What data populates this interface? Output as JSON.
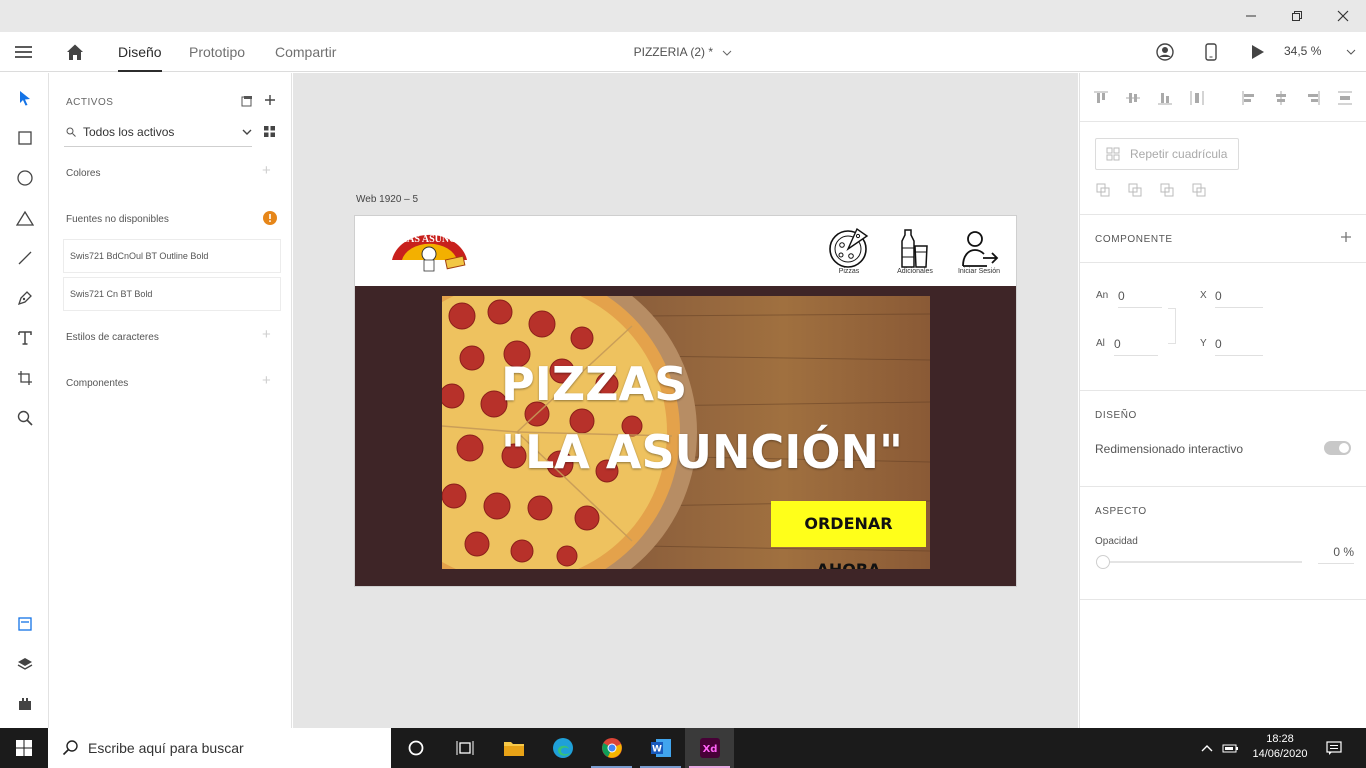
{
  "window": {
    "minimize_icon": "minimize-icon",
    "maximize_icon": "restore-icon",
    "close_icon": "close-icon"
  },
  "topbar": {
    "tabs": [
      {
        "label": "Diseño"
      },
      {
        "label": "Prototipo"
      },
      {
        "label": "Compartir"
      }
    ],
    "document_title": "PIZZERIA (2) *",
    "zoom": "34,5 %"
  },
  "assets": {
    "header": "ACTIVOS",
    "filter": "Todos los activos",
    "sections": {
      "colors": "Colores",
      "missing_fonts": "Fuentes no disponibles",
      "char_styles": "Estilos de caracteres",
      "components": "Componentes"
    },
    "missing_fonts": [
      "Swis721 BdCnOul BT Outline Bold",
      "Swis721 Cn BT Bold"
    ]
  },
  "canvas": {
    "artboard_label": "Web 1920 – 5",
    "logo_text": "PIZZAS ASUNCION",
    "nav": [
      {
        "label": "Pizzas",
        "icon": "pizza-icon"
      },
      {
        "label": "Adicionales",
        "icon": "drinks-icon"
      },
      {
        "label": "Iniciar Sesión",
        "icon": "login-icon"
      }
    ],
    "hero_line1": "PIZZAS",
    "hero_line2": "\"LA ASUNCIÓN\"",
    "cta": "ORDENAR AHORA",
    "hero_bg_color": "#3e2527",
    "cta_color": "#ffff1a"
  },
  "properties": {
    "repeat_grid": "Repetir cuadrícula",
    "component_header": "COMPONENTE",
    "width_label": "An",
    "width_value": "0",
    "height_label": "Al",
    "height_value": "0",
    "x_label": "X",
    "x_value": "0",
    "y_label": "Y",
    "y_value": "0",
    "design_header": "DISEÑO",
    "responsive_resize": "Redimensionado interactivo",
    "appearance_header": "ASPECTO",
    "opacity_label": "Opacidad",
    "opacity_value": "0 %"
  },
  "taskbar": {
    "search_placeholder": "Escribe aquí para buscar",
    "time": "18:28",
    "date": "14/06/2020"
  }
}
